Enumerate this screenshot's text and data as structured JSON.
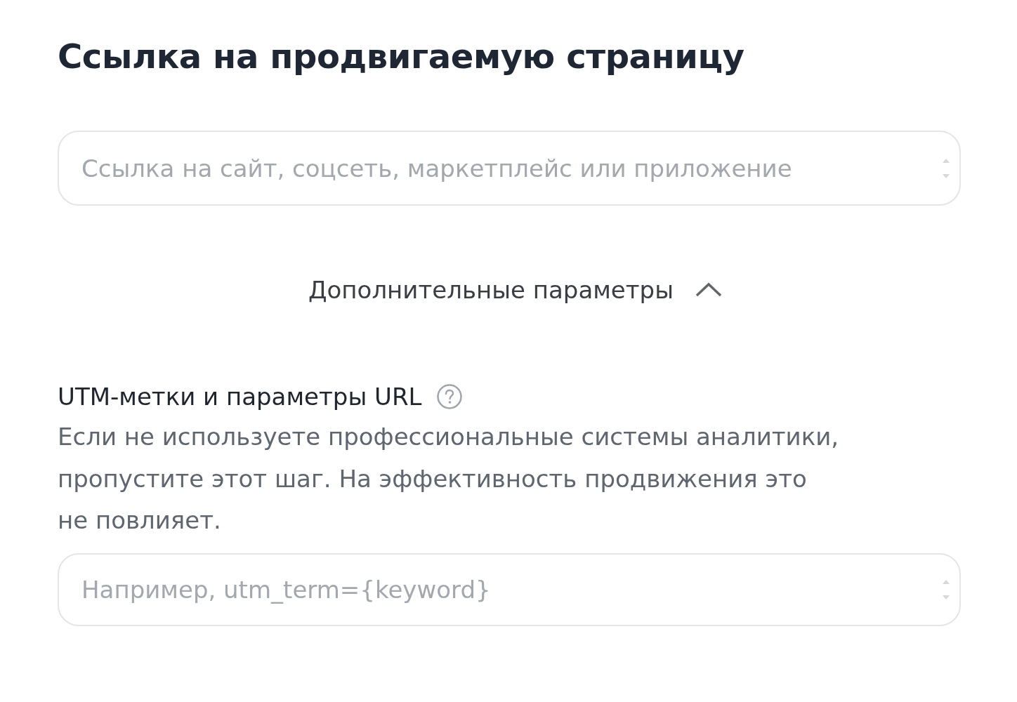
{
  "heading": "Ссылка на продвигаемую страницу",
  "url_field": {
    "placeholder": "Ссылка на сайт, соцсеть, маркетплейс или приложение"
  },
  "advanced_toggle": {
    "label": "Дополнительные параметры",
    "expanded": true
  },
  "utm": {
    "label": "UTM-метки и параметры URL",
    "description": "Если не используете профессиональные системы аналитики, пропустите этот шаг. На эффективность продвижения это не повлияет.",
    "field": {
      "placeholder": "Например, utm_term={keyword}"
    }
  }
}
